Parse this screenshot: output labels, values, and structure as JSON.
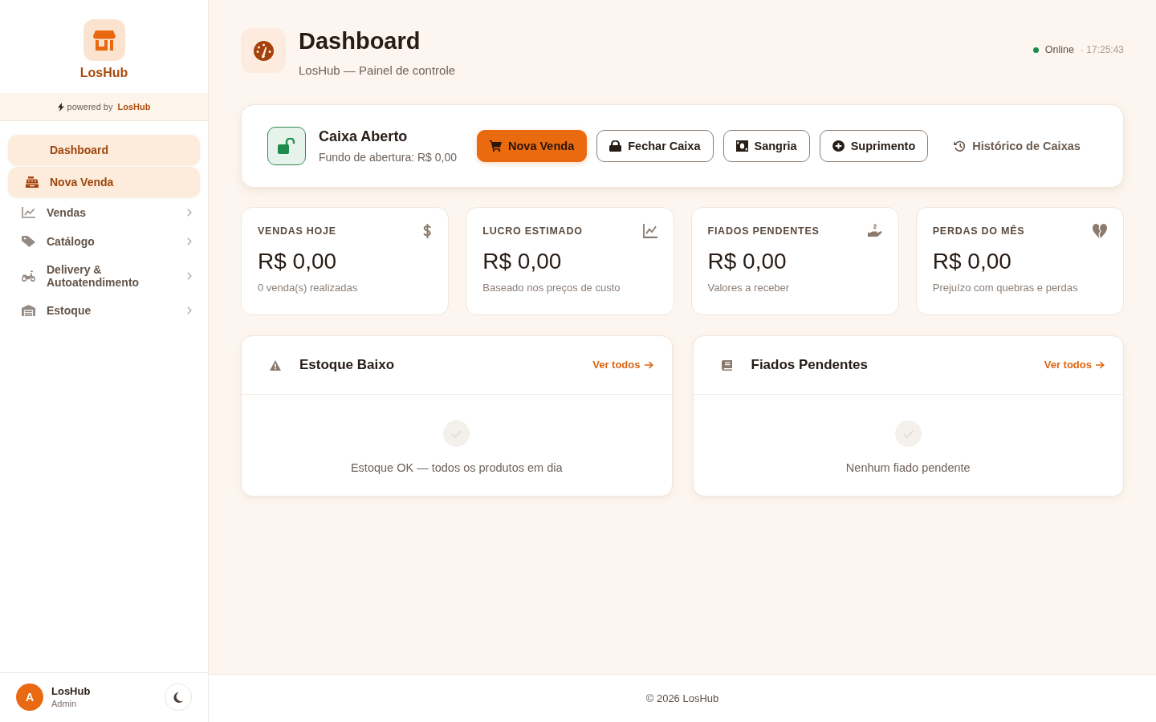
{
  "sidebar": {
    "brand": "LosHub",
    "powered_by": {
      "label": "powered by",
      "brand": "LosHub"
    },
    "items": [
      {
        "label": "Dashboard",
        "kind": "link",
        "selected": true
      },
      {
        "label": "Nova Venda",
        "kind": "link",
        "selected": true
      },
      {
        "label": "Vendas",
        "kind": "group",
        "selected": false,
        "expanded": false
      },
      {
        "label": "Catálogo",
        "kind": "group",
        "selected": false,
        "expanded": false
      },
      {
        "label": "Delivery & Autoatendimento",
        "kind": "group",
        "selected": false,
        "expanded": false
      },
      {
        "label": "Estoque",
        "kind": "group",
        "selected": false,
        "expanded": false
      }
    ],
    "user": {
      "initial": "A",
      "name": "LosHub",
      "role": "Admin"
    }
  },
  "header": {
    "title": "Dashboard",
    "subtitle": "LosHub — Painel de controle",
    "online": true,
    "status": "Online",
    "time": "· 17:25:43"
  },
  "cash_register": {
    "open": true,
    "title": "Caixa Aberto",
    "subtitle": "Fundo de abertura: R$ 0,00",
    "buttons": [
      {
        "label": "Nova Venda",
        "kind": "primary"
      },
      {
        "label": "Fechar Caixa",
        "kind": "outline"
      },
      {
        "label": "Sangria",
        "kind": "outline"
      },
      {
        "label": "Suprimento",
        "kind": "outline"
      },
      {
        "label": "Histórico de Caixas",
        "kind": "link"
      }
    ]
  },
  "stats": [
    {
      "label": "VENDAS HOJE",
      "value": "R$ 0,00",
      "note": "0 venda(s) realizadas"
    },
    {
      "label": "LUCRO ESTIMADO",
      "value": "R$ 0,00",
      "note": "Baseado nos preços de custo"
    },
    {
      "label": "FIADOS PENDENTES",
      "value": "R$ 0,00",
      "note": "Valores a receber"
    },
    {
      "label": "PERDAS DO MÊS",
      "value": "R$ 0,00",
      "note": "Prejuízo com quebras e perdas"
    }
  ],
  "panels": [
    {
      "title": "Estoque Baixo",
      "link": "Ver todos",
      "empty_text": "Estoque OK — todos os produtos em dia"
    },
    {
      "title": "Fiados Pendentes",
      "link": "Ver todos",
      "empty_text": "Nenhum fiado pendente"
    }
  ],
  "footer": "© 2026 LosHub"
}
